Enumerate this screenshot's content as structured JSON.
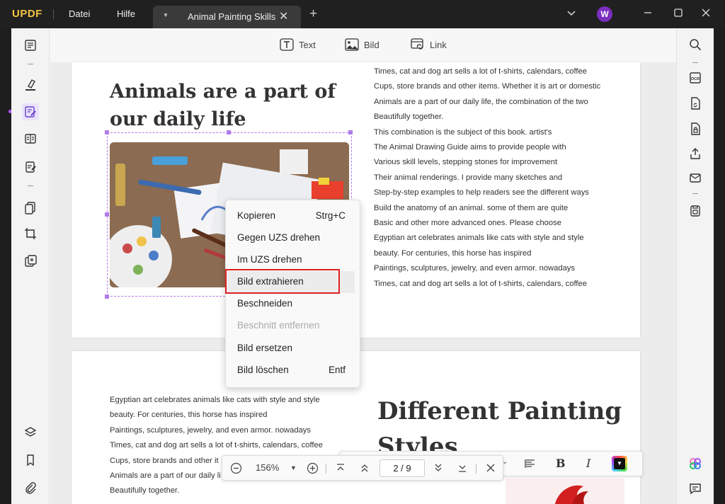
{
  "app": {
    "logo": "UPDF"
  },
  "menubar": {
    "file": "Datei",
    "help": "Hilfe"
  },
  "tab": {
    "title": "Animal Painting Skills",
    "close": "✕"
  },
  "new_tab_label": "+",
  "user": {
    "initial": "W"
  },
  "window_controls": {
    "chevron": "⌄",
    "minimize": "—",
    "maximize": "☐",
    "close": "✕"
  },
  "toolbar": {
    "text": "Text",
    "image": "Bild",
    "link": "Link"
  },
  "page1": {
    "heading_line1": "Animals are a part of",
    "heading_line2": "our daily life",
    "paragraph": [
      "Times, cat and dog art sells a lot of t-shirts, calendars, coffee",
      "Cups, store brands and other items. Whether it is art or domestic",
      "Animals are a part of our daily life, the combination of the two",
      "Beautifully together.",
      "This combination is the subject of this book. artist's",
      "The Animal Drawing Guide aims to provide people with",
      "Various skill levels, stepping stones for improvement",
      "Their animal renderings. I provide many sketches and",
      "Step-by-step examples to help readers see the different ways",
      "Build the anatomy of an animal. some of them are quite",
      "Basic and other more advanced ones. Please choose",
      "Egyptian art celebrates animals like cats with style and style",
      "beauty. For centuries, this horse has inspired",
      "Paintings, sculptures, jewelry, and even armor. nowadays",
      "Times, cat and dog art sells a lot of t-shirts, calendars, coffee"
    ]
  },
  "page2": {
    "heading_line1": "Different Painting",
    "heading_line2": "Styles",
    "paragraph": [
      "Egyptian art celebrates animals like cats with style and style",
      "beauty. For centuries, this horse has inspired",
      "Paintings, sculptures, jewelry, and even armor. nowadays",
      "Times, cat and dog art sells a lot of t-shirts, calendars, coffee",
      "Cups, store brands and other it",
      "Animals are a part of our daily li",
      "Beautifully together."
    ]
  },
  "context_menu": [
    {
      "label": "Kopieren",
      "shortcut": "Strg+C",
      "disabled": false
    },
    {
      "label": "Gegen UZS drehen",
      "shortcut": "",
      "disabled": false
    },
    {
      "label": "Im UZS drehen",
      "shortcut": "",
      "disabled": false
    },
    {
      "label": "Bild extrahieren",
      "shortcut": "",
      "disabled": false
    },
    {
      "label": "Beschneiden",
      "shortcut": "",
      "disabled": false
    },
    {
      "label": "Beschnitt entfernen",
      "shortcut": "",
      "disabled": true
    },
    {
      "label": "Bild ersetzen",
      "shortcut": "",
      "disabled": false
    },
    {
      "label": "Bild löschen",
      "shortcut": "Entf",
      "disabled": false
    }
  ],
  "format_bar": {
    "bold": "B",
    "italic": "I"
  },
  "nav": {
    "zoom": "156%",
    "page": "2 / 9"
  },
  "colors": {
    "accent": "#a855f7",
    "highlight": "#e02020",
    "selection": "#b07ce8"
  }
}
